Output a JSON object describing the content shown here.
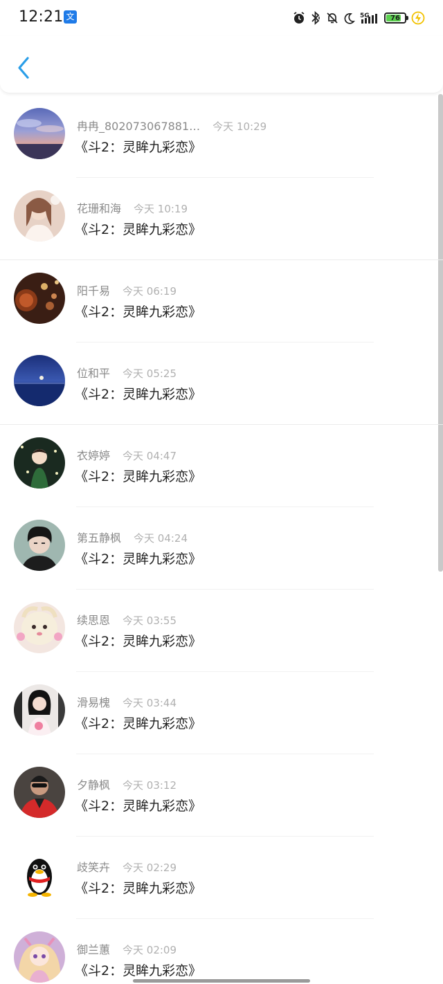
{
  "status_bar": {
    "time": "12:21",
    "app_badge_glyph": "文",
    "battery": "76",
    "network": "5G",
    "icons": [
      "alarm-icon",
      "bluetooth-icon",
      "mute-bell-icon",
      "moon-icon",
      "signal-5g-icon",
      "battery-icon",
      "charging-icon"
    ]
  },
  "nav": {
    "back_icon": "chevron-left-icon",
    "accent_color": "#2a9ee8"
  },
  "comments": [
    {
      "name": "冉冉_802073067881…",
      "time": "今天 10:29",
      "text": "《斗2：灵眸九彩恋》",
      "avatar": "sunset-sky"
    },
    {
      "name": "花珊和海",
      "time": "今天 10:19",
      "text": "《斗2：灵眸九彩恋》",
      "avatar": "girl-light"
    },
    {
      "name": "阳千易",
      "time": "今天 06:19",
      "text": "《斗2：灵眸九彩恋》",
      "avatar": "bokeh-lamp"
    },
    {
      "name": "位和平",
      "time": "今天 05:25",
      "text": "《斗2：灵眸九彩恋》",
      "avatar": "moon-sea"
    },
    {
      "name": "衣婷婷",
      "time": "今天 04:47",
      "text": "《斗2：灵眸九彩恋》",
      "avatar": "child-dark"
    },
    {
      "name": "第五静枫",
      "time": "今天 04:24",
      "text": "《斗2：灵眸九彩恋》",
      "avatar": "boy-portrait"
    },
    {
      "name": "续思恩",
      "time": "今天 03:55",
      "text": "《斗2：灵眸九彩恋》",
      "avatar": "fluffy-pet"
    },
    {
      "name": "滑易槐",
      "time": "今天 03:44",
      "text": "《斗2：灵眸九彩恋》",
      "avatar": "girl-dark-hair"
    },
    {
      "name": "夕静枫",
      "time": "今天 03:12",
      "text": "《斗2：灵眸九彩恋》",
      "avatar": "man-sunglasses"
    },
    {
      "name": "歧笑卉",
      "time": "今天 02:29",
      "text": "《斗2：灵眸九彩恋》",
      "avatar": "penguin"
    },
    {
      "name": "御兰蕙",
      "time": "今天 02:09",
      "text": "《斗2：灵眸九彩恋》",
      "avatar": "anime-girl"
    }
  ]
}
